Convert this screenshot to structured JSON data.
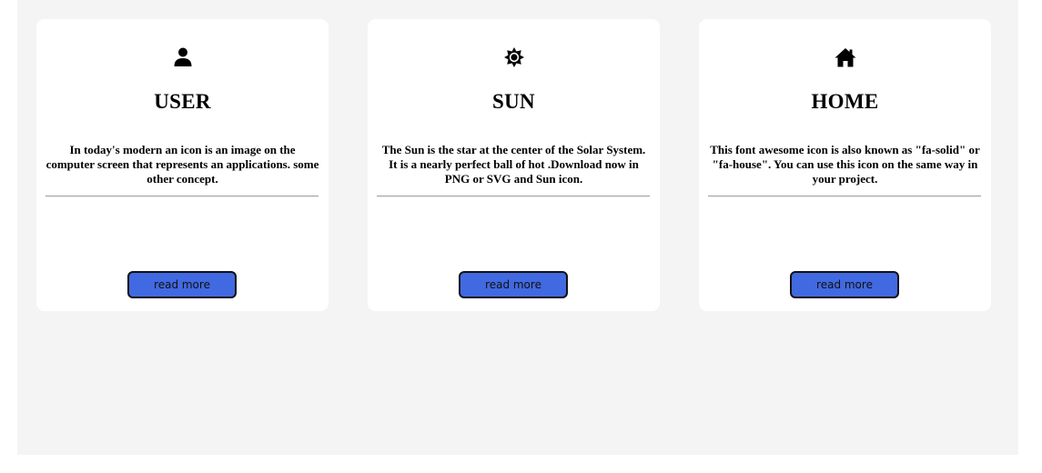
{
  "cards": [
    {
      "icon": "user-icon",
      "title": "USER",
      "description": "In today's modern an icon is an image on the computer screen that represents an applications. some other concept.",
      "button_label": "read more"
    },
    {
      "icon": "sun-icon",
      "title": "SUN",
      "description": "The Sun is the star at the center of the Solar System. It is a nearly perfect ball of hot .Download now in PNG or SVG and Sun icon.",
      "button_label": "read more"
    },
    {
      "icon": "house-icon",
      "title": "HOME",
      "description": "This font awesome icon is also known as \"fa-solid\" or \"fa-house\". You can use this icon on the same way in your project.",
      "button_label": "read more"
    }
  ],
  "colors": {
    "page_background": "#f4f4f4",
    "card_background": "#ffffff",
    "button_background": "#4169e1",
    "divider": "#9a9a9a"
  }
}
